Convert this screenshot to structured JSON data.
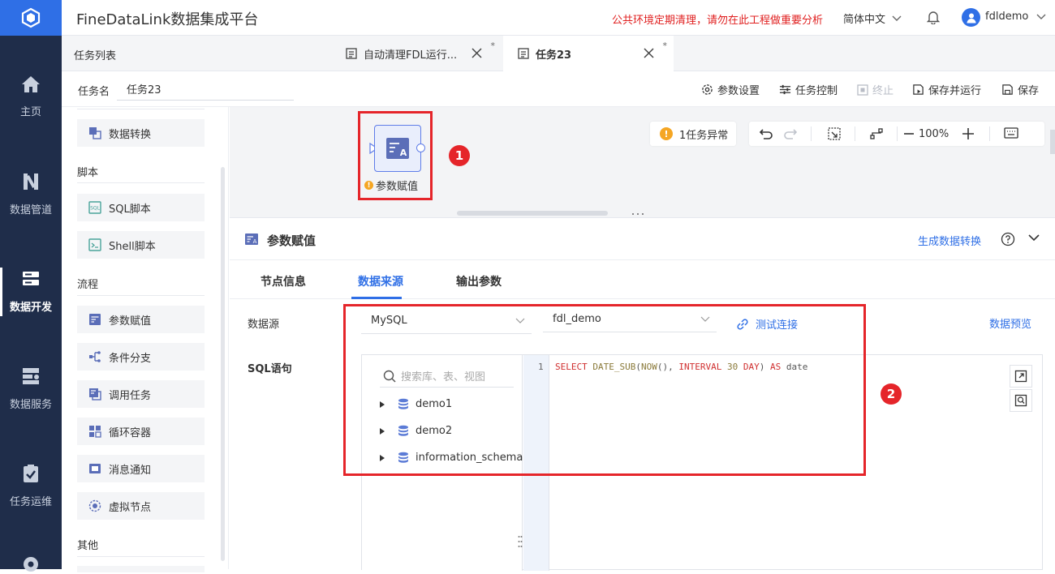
{
  "app": {
    "title": "FineDataLink数据集成平台",
    "notice": "公共环境定期清理，请勿在此工程做重要分析",
    "language": "简体中文",
    "username": "fdldemo"
  },
  "nav": {
    "items": [
      {
        "label": "主页",
        "icon": "home-icon"
      },
      {
        "label": "数据管道",
        "icon": "pipeline-icon"
      },
      {
        "label": "数据开发",
        "icon": "dev-icon",
        "active": true
      },
      {
        "label": "数据服务",
        "icon": "service-icon"
      },
      {
        "label": "任务运维",
        "icon": "ops-icon"
      }
    ]
  },
  "tabs": {
    "task_list": "任务列表",
    "items": [
      {
        "label": "自动清理FDL运行...",
        "modified": "*"
      },
      {
        "label": "任务23",
        "modified": "*",
        "active": true
      }
    ]
  },
  "toolbar": {
    "task_name_label": "任务名",
    "task_name_value": "任务23",
    "param_settings": "参数设置",
    "task_control": "任务控制",
    "terminate": "终止",
    "save_and_run": "保存并运行",
    "save": "保存"
  },
  "node_panel": {
    "top_item": "数据转换",
    "sections": [
      {
        "title": "脚本",
        "items": [
          "SQL脚本",
          "Shell脚本"
        ]
      },
      {
        "title": "流程",
        "items": [
          "参数赋值",
          "条件分支",
          "调用任务",
          "循环容器",
          "消息通知",
          "虚拟节点"
        ]
      },
      {
        "title": "其他",
        "items": []
      }
    ]
  },
  "canvas": {
    "node_label": "参数赋值",
    "warn_mark": "!",
    "anomaly": "1任务异常",
    "zoom": "100%",
    "badges": [
      "1",
      "2"
    ]
  },
  "config": {
    "title": "参数赋值",
    "generate_convert": "生成数据转换",
    "tabs": [
      "节点信息",
      "数据来源",
      "输出参数"
    ],
    "active_tab": "数据来源",
    "datasource_label": "数据源",
    "datasource_type": "MySQL",
    "datasource_conn": "fdl_demo",
    "test_connection": "测试连接",
    "data_preview": "数据预览",
    "sql_label": "SQL语句",
    "search_placeholder": "搜索库、表、视图",
    "databases": [
      "demo1",
      "demo2",
      "information_schema"
    ],
    "line_number": "1",
    "sql": "SELECT DATE_SUB(NOW(), INTERVAL 30 DAY) AS date"
  },
  "colors": {
    "primary": "#2f6fe6",
    "nav_bg": "#1f2d4a",
    "highlight_red": "#e5252a",
    "warning": "#f5a623"
  }
}
